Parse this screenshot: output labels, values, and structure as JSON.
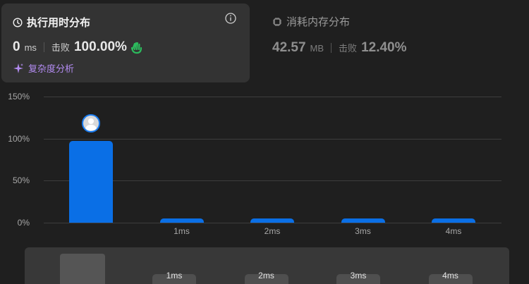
{
  "runtime": {
    "title": "执行用时分布",
    "value": "0",
    "unit": "ms",
    "beat_label": "击败",
    "beat_value": "100.00%",
    "analysis_label": "复杂度分析"
  },
  "memory": {
    "title": "消耗内存分布",
    "value": "42.57",
    "unit": "MB",
    "beat_label": "击败",
    "beat_value": "12.40%"
  },
  "colors": {
    "bar": "#0a6fe6",
    "accent": "#b28bf0",
    "clap": "#2cbb5d"
  },
  "chart_data": {
    "type": "bar",
    "categories": [
      "",
      "1ms",
      "2ms",
      "3ms",
      "4ms"
    ],
    "values": [
      97,
      5,
      5,
      5,
      5
    ],
    "ylim": [
      0,
      150
    ],
    "yticks": [
      "150%",
      "100%",
      "50%",
      "0%"
    ],
    "grid": true,
    "highlighted_category_index": 0
  },
  "navigator": {
    "labels": [
      "1ms",
      "2ms",
      "3ms",
      "4ms"
    ]
  }
}
